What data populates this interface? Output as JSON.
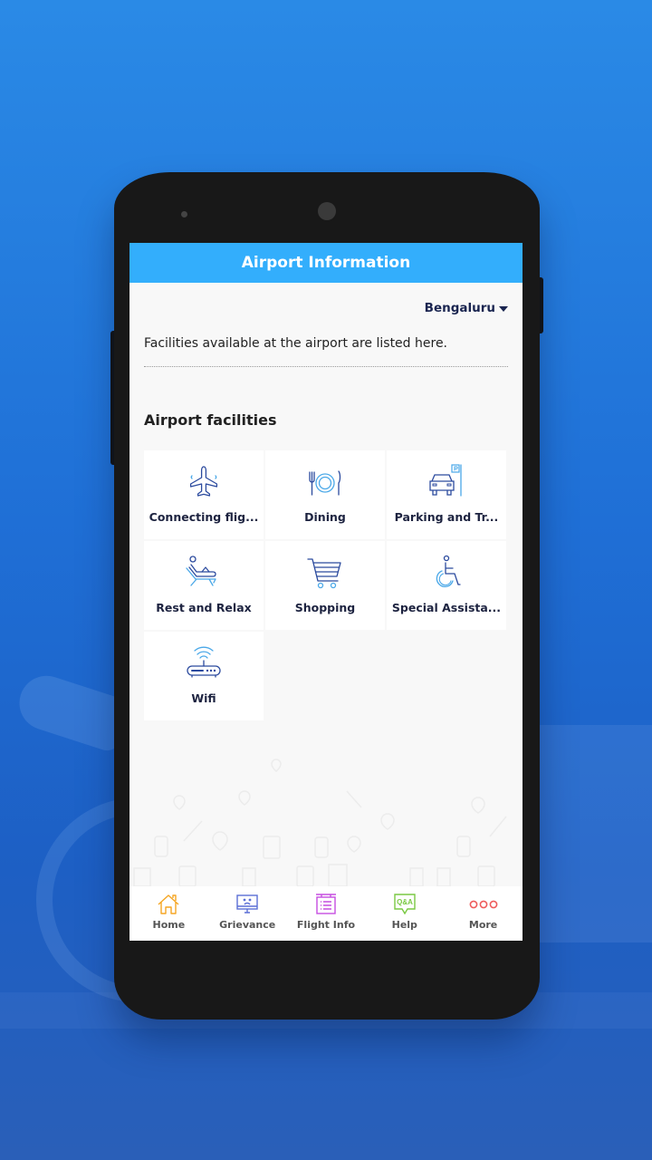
{
  "app": {
    "title": "Airport Information",
    "accent_color": "#33aefc"
  },
  "city_selector": {
    "selected": "Bengaluru",
    "icon": "caret-down-icon"
  },
  "intro_text": "Facilities available at the airport are listed here.",
  "section": {
    "title": "Airport facilities"
  },
  "facilities": [
    {
      "label": "Connecting flig...",
      "icon": "airplane-icon"
    },
    {
      "label": "Dining",
      "icon": "dining-plate-icon"
    },
    {
      "label": "Parking and Tr...",
      "icon": "car-parking-icon"
    },
    {
      "label": "Rest and Relax",
      "icon": "lounge-chair-icon"
    },
    {
      "label": "Shopping",
      "icon": "shopping-cart-icon"
    },
    {
      "label": "Special Assista...",
      "icon": "wheelchair-icon"
    },
    {
      "label": "Wifi",
      "icon": "wifi-router-icon"
    }
  ],
  "bottom_nav": [
    {
      "label": "Home",
      "icon": "home-icon",
      "color": "#f5a623"
    },
    {
      "label": "Grievance",
      "icon": "monitor-sad-icon",
      "color": "#5b6fd6"
    },
    {
      "label": "Flight Info",
      "icon": "flight-board-icon",
      "color": "#c64ee0"
    },
    {
      "label": "Help",
      "icon": "qa-chat-icon",
      "color": "#7ac943"
    },
    {
      "label": "More",
      "icon": "more-dots-icon",
      "color": "#ee5a5a"
    }
  ]
}
